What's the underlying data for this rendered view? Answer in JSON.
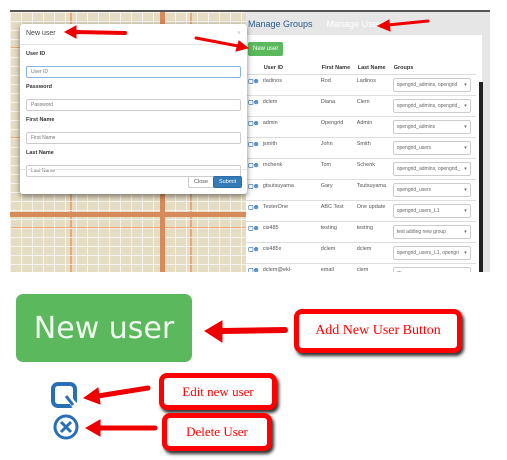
{
  "nav": {
    "manage_groups": "Manage Groups",
    "manage_users": "Manage Users"
  },
  "new_user_button": "New user",
  "table": {
    "headers": [
      "",
      "User ID",
      "First Name",
      "Last Name",
      "Groups"
    ],
    "rows": [
      {
        "id": "rladinos",
        "first": "Rod",
        "last": "Ladinos",
        "groups": "opengrid_admins, opengrid"
      },
      {
        "id": "dclem",
        "first": "Diana",
        "last": "Clem",
        "groups": "opengrid_admins, opengrid_"
      },
      {
        "id": "admin",
        "first": "Opengrid",
        "last": "Admin",
        "groups": "opengrid_admins"
      },
      {
        "id": "jsmith",
        "first": "John",
        "last": "Smith",
        "groups": "opengrid_users"
      },
      {
        "id": "rnchenk",
        "first": "Tom",
        "last": "Schenk",
        "groups": "opengrid_admins, opengrid_"
      },
      {
        "id": "gtsutsuyama",
        "first": "Gary",
        "last": "Tsutsuyama",
        "groups": "opengrid_users"
      },
      {
        "id": "TesterOne",
        "first": "ABC Test",
        "last": "One update",
        "groups": "opengrid_users_L1"
      },
      {
        "id": "cis485",
        "first": "testing",
        "last": "testing",
        "groups": "test adding new group"
      },
      {
        "id": "cis485x",
        "first": "dclem",
        "last": "dclem",
        "groups": "opengrid_users_L1, opengri"
      },
      {
        "id": "dclem@ekl-consulting.com",
        "first": "email",
        "last": "clem",
        "groups": "Choose groups..."
      }
    ]
  },
  "modal": {
    "title": "New user",
    "close_x": "×",
    "fields": [
      {
        "label": "User ID",
        "placeholder": "User ID"
      },
      {
        "label": "Password",
        "placeholder": "Password"
      },
      {
        "label": "First Name",
        "placeholder": "First Name"
      },
      {
        "label": "Last Name",
        "placeholder": "Last Name"
      }
    ],
    "close": "Close",
    "submit": "Submit"
  },
  "legend": {
    "big_button": "New user",
    "add_label": "Add New User Button",
    "edit_label": "Edit new user",
    "delete_label": "Delete User"
  },
  "colors": {
    "success": "#5cb85c",
    "primary": "#337ab7",
    "annotation": "#ff0000"
  }
}
